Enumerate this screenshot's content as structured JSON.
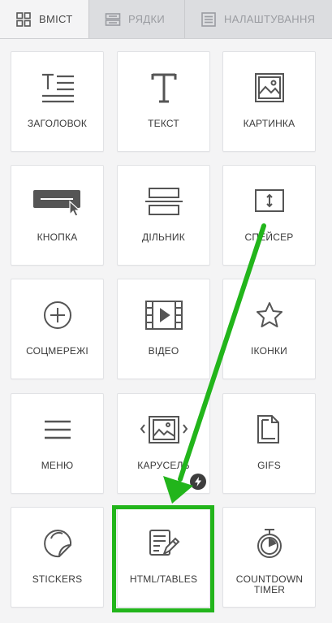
{
  "tabs": [
    {
      "label": "ВМІСТ",
      "icon": "grid-icon",
      "active": true
    },
    {
      "label": "РЯДКИ",
      "icon": "rows-icon",
      "active": false
    },
    {
      "label": "НАЛАШТУВАННЯ",
      "icon": "settings-panel-icon",
      "active": false
    }
  ],
  "tiles": [
    {
      "label": "ЗАГОЛОВОК",
      "icon": "heading-icon"
    },
    {
      "label": "ТЕКСТ",
      "icon": "text-icon"
    },
    {
      "label": "КАРТИНКА",
      "icon": "image-icon"
    },
    {
      "label": "КНОПКА",
      "icon": "button-icon"
    },
    {
      "label": "ДІЛЬНИК",
      "icon": "divider-icon"
    },
    {
      "label": "СПЕЙСЕР",
      "icon": "spacer-icon"
    },
    {
      "label": "СОЦМЕРЕЖІ",
      "icon": "social-icon"
    },
    {
      "label": "ВІДЕО",
      "icon": "video-icon"
    },
    {
      "label": "ІКОНКИ",
      "icon": "star-icon"
    },
    {
      "label": "МЕНЮ",
      "icon": "menu-icon"
    },
    {
      "label": "КАРУСЕЛЬ",
      "icon": "carousel-icon"
    },
    {
      "label": "GIFS",
      "icon": "gif-icon"
    },
    {
      "label": "STICKERS",
      "icon": "sticker-icon"
    },
    {
      "label": "HTML/TABLES",
      "icon": "html-tables-icon"
    },
    {
      "label": "COUNTDOWN TIMER",
      "icon": "timer-icon"
    }
  ],
  "colors": {
    "highlight": "#22b51b",
    "panel_bg": "#f4f4f5",
    "tab_bar_bg": "#dcdde0",
    "icon": "#555555"
  }
}
